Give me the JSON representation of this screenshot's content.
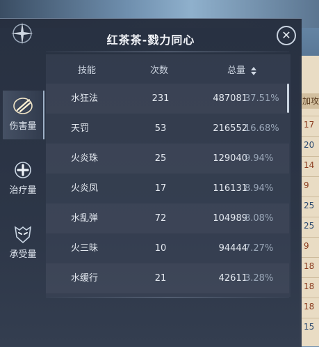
{
  "panel": {
    "title": "红茶茶-戮力同心",
    "close_label": "✕"
  },
  "tabs": [
    {
      "label": "伤害量",
      "icon": "sword-damage-icon",
      "active": true
    },
    {
      "label": "治疗量",
      "icon": "heal-cross-icon",
      "active": false
    },
    {
      "label": "承受量",
      "icon": "shield-mask-icon",
      "active": false
    }
  ],
  "table": {
    "headers": {
      "skill": "技能",
      "count": "次数",
      "total": "总量"
    },
    "rows": [
      {
        "skill": "水狂法",
        "count": "231",
        "total": "487081",
        "pct": "37.51%"
      },
      {
        "skill": "天罚",
        "count": "53",
        "total": "216552",
        "pct": "16.68%"
      },
      {
        "skill": "火炎珠",
        "count": "25",
        "total": "129040",
        "pct": "9.94%"
      },
      {
        "skill": "火炎凤",
        "count": "17",
        "total": "116131",
        "pct": "8.94%"
      },
      {
        "skill": "水乱弹",
        "count": "72",
        "total": "104989",
        "pct": "8.08%"
      },
      {
        "skill": "火三昧",
        "count": "10",
        "total": "94444",
        "pct": "7.27%"
      },
      {
        "skill": "水缓行",
        "count": "21",
        "total": "42611",
        "pct": "3.28%"
      }
    ]
  },
  "background_right": {
    "header": "加攻",
    "values": [
      "17",
      "20",
      "14",
      "9",
      "25",
      "25",
      "9",
      "18",
      "18",
      "18",
      "15"
    ]
  }
}
